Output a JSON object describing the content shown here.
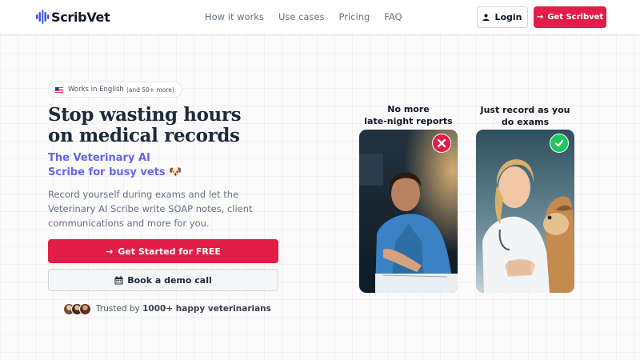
{
  "header": {
    "logo_text": "ScribVet",
    "nav": [
      "How it works",
      "Use cases",
      "Pricing",
      "FAQ"
    ],
    "login_label": "Login",
    "cta_label": "Get Scribvet"
  },
  "hero": {
    "badge_main": "Works in English",
    "badge_small": "(and 50+ more)",
    "title_line1": "Stop wasting hours",
    "title_line2": "on medical records",
    "subtitle_line1": "The Veterinary AI",
    "subtitle_line2": "Scribe for busy vets 🐶",
    "description": "Record yourself during exams and let the Veterinary AI Scribe write SOAP notes, client communications and more for you.",
    "primary_cta": "Get Started for FREE",
    "secondary_cta": "Book a demo call",
    "trusted_prefix": "Trusted by ",
    "trusted_count": "1000+ happy veterinarians"
  },
  "comparison": {
    "before_line1": "No more",
    "before_line2": "late-night reports",
    "after_line1": "Just record as you",
    "after_line2": "do exams",
    "before_icon": "x-icon",
    "after_icon": "check-icon"
  },
  "colors": {
    "accent": "#e11d48",
    "subtitle": "#6366f1",
    "bad": "#e11d48",
    "good": "#22c55e"
  }
}
